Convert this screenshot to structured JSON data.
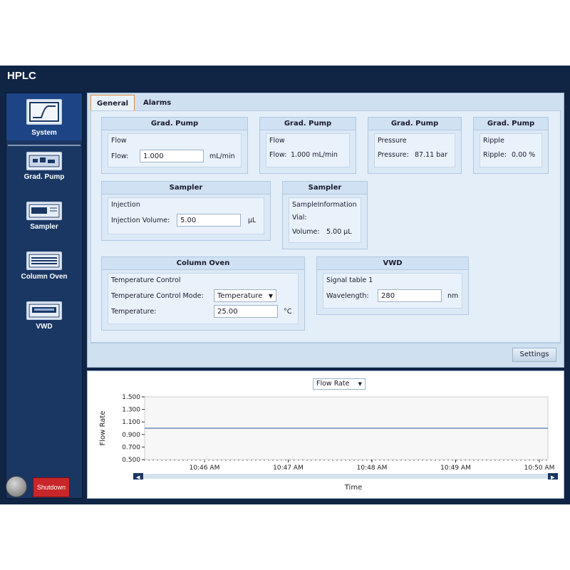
{
  "app": {
    "title": "HPLC"
  },
  "sidebar": {
    "items": [
      {
        "label": "System",
        "icon": "system-icon"
      },
      {
        "label": "Grad. Pump",
        "icon": "pump-icon"
      },
      {
        "label": "Sampler",
        "icon": "sampler-icon"
      },
      {
        "label": "Column Oven",
        "icon": "column-oven-icon"
      },
      {
        "label": "VWD",
        "icon": "vwd-icon"
      }
    ],
    "shutdown_label": "Shutdown"
  },
  "tabs": [
    "General",
    "Alarms"
  ],
  "groups": {
    "pump_flow": {
      "title": "Grad. Pump",
      "section": "Flow",
      "label": "Flow:",
      "value": "1.000",
      "unit": "mL/min"
    },
    "pump_flow_read": {
      "title": "Grad. Pump",
      "section": "Flow",
      "label": "Flow:",
      "value": "1.000 mL/min"
    },
    "pump_pressure": {
      "title": "Grad. Pump",
      "section": "Pressure",
      "label": "Pressure:",
      "value": "87.11 bar"
    },
    "pump_ripple": {
      "title": "Grad. Pump",
      "section": "Ripple",
      "label": "Ripple:",
      "value": "0.00 %"
    },
    "sampler_inj": {
      "title": "Sampler",
      "section": "Injection",
      "label": "Injection Volume:",
      "value": "5.00",
      "unit": "µL"
    },
    "sampler_info": {
      "title": "Sampler",
      "section": "SampleInformation",
      "vial_label": "Vial:",
      "vol_label": "Volume:",
      "vol_value": "5.00 µL"
    },
    "oven": {
      "title": "Column Oven",
      "section": "Temperature Control",
      "mode_label": "Temperature Control Mode:",
      "mode_value": "Temperature",
      "temp_label": "Temperature:",
      "temp_value": "25.00",
      "temp_unit": "°C"
    },
    "vwd": {
      "title": "VWD",
      "section": "Signal table 1",
      "label": "Wavelength:",
      "value": "280",
      "unit": "nm"
    }
  },
  "settings_label": "Settings",
  "chart_select": "Flow Rate",
  "chart_data": {
    "type": "line",
    "xlabel": "Time",
    "ylabel": "Flow Rate",
    "ylim": [
      0.5,
      1.5
    ],
    "yticks": [
      "1.500",
      "1.300",
      "1.100",
      "0.900",
      "0.700",
      "0.500"
    ],
    "xticks": [
      "10:46 AM",
      "10:47 AM",
      "10:48 AM",
      "10:49 AM",
      "10:50 AM"
    ],
    "series": [
      {
        "x": [
          0,
          1
        ],
        "y": [
          1.0,
          1.0
        ]
      }
    ],
    "grid": false
  },
  "colors": {
    "sidebar_bg": "#1a3764",
    "shutdown": "#c8262a",
    "tab_accent": "#e38a3a",
    "line": "#6f8fbf"
  }
}
